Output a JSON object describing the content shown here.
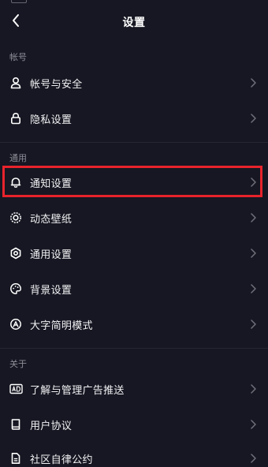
{
  "header": {
    "title": "设置",
    "back_icon": "chevron-left-icon"
  },
  "sections": {
    "account": {
      "title": "帐号",
      "items": [
        {
          "label": "帐号与安全",
          "icon": "user-icon"
        },
        {
          "label": "隐私设置",
          "icon": "lock-icon"
        }
      ]
    },
    "general": {
      "title": "通用",
      "items": [
        {
          "label": "通知设置",
          "icon": "bell-icon"
        },
        {
          "label": "动态壁纸",
          "icon": "live-wallpaper-icon"
        },
        {
          "label": "通用设置",
          "icon": "gear-icon"
        },
        {
          "label": "背景设置",
          "icon": "palette-icon"
        },
        {
          "label": "大字简明模式",
          "icon": "large-text-icon"
        }
      ]
    },
    "about": {
      "title": "关于",
      "items": [
        {
          "label": "了解与管理广告推送",
          "icon": "ad-icon"
        },
        {
          "label": "用户协议",
          "icon": "book-icon"
        },
        {
          "label": "社区自律公约",
          "icon": "document-icon"
        }
      ]
    }
  },
  "highlight": {
    "target": "通知设置",
    "color": "#e8232c"
  },
  "colors": {
    "background": "#161722",
    "section_text": "#8d8e98",
    "item_text": "#f2f2f4",
    "chevron": "#6f707a"
  }
}
